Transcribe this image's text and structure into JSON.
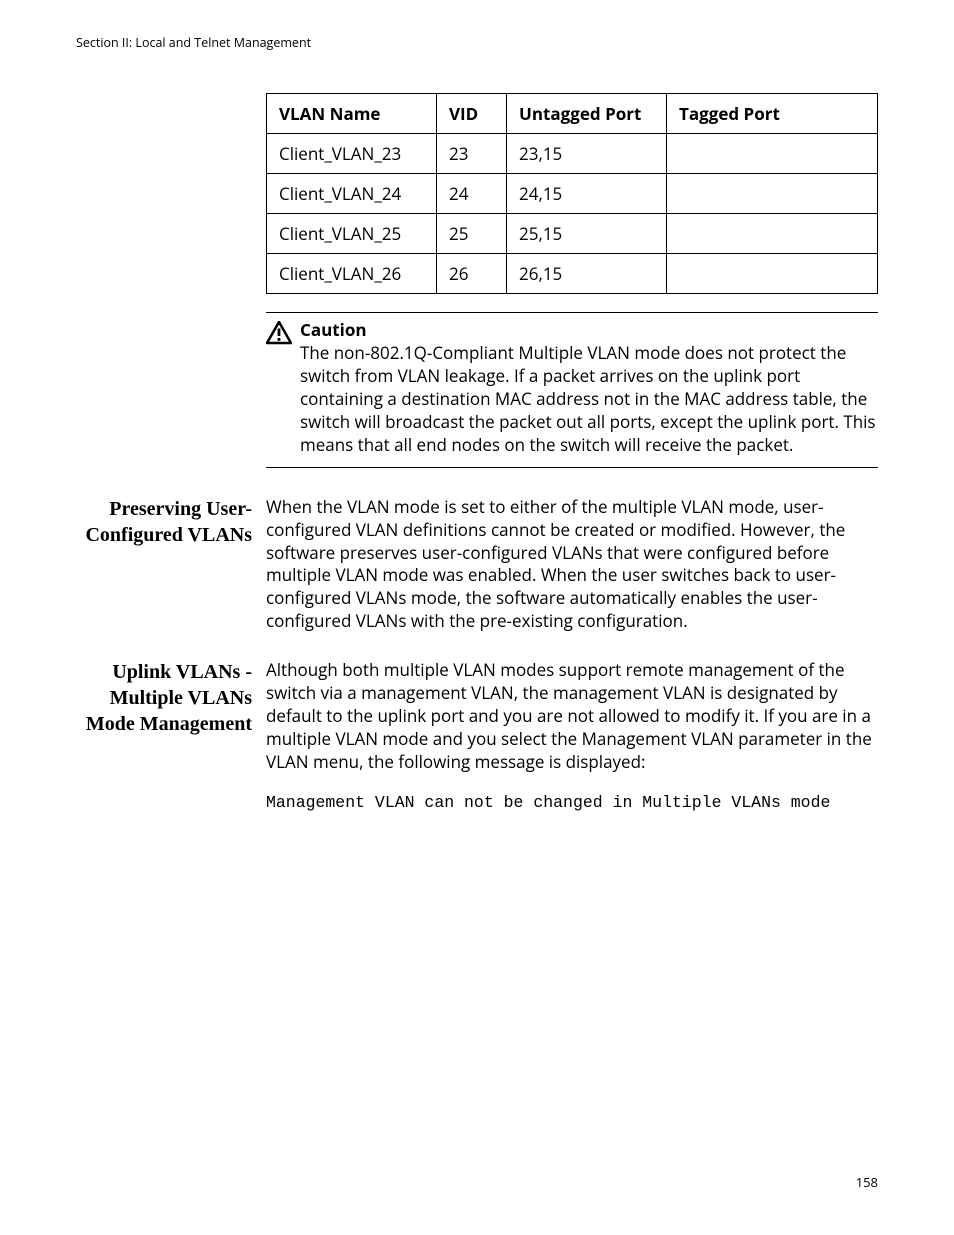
{
  "running_head": "Section II: Local and Telnet Management",
  "page_number": "158",
  "table": {
    "headers": [
      "VLAN Name",
      "VID",
      "Untagged Port",
      "Tagged Port"
    ],
    "rows": [
      {
        "name": "Client_VLAN_23",
        "vid": "23",
        "untagged": "23,15",
        "tagged": ""
      },
      {
        "name": "Client_VLAN_24",
        "vid": "24",
        "untagged": "24,15",
        "tagged": ""
      },
      {
        "name": "Client_VLAN_25",
        "vid": "25",
        "untagged": "25,15",
        "tagged": ""
      },
      {
        "name": "Client_VLAN_26",
        "vid": "26",
        "untagged": "26,15",
        "tagged": ""
      }
    ]
  },
  "caution": {
    "label": "Caution",
    "text": "The non-802.1Q-Compliant Multiple VLAN mode does not protect the switch from VLAN leakage. If a packet arrives on the uplink port containing a destination MAC address not in the MAC address table, the switch will broadcast the packet out all ports, except the uplink port. This means that all end nodes on the switch will receive the packet."
  },
  "sections": {
    "preserving": {
      "heading": "Preserving User-Configured VLANs",
      "body": "When the VLAN mode is set to either of the multiple VLAN mode, user-configured VLAN definitions cannot be created or modified. However, the software preserves user-configured VLANs that were configured before multiple VLAN mode was enabled. When the user switches back to user-configured VLANs mode, the software automatically enables the user-configured VLANs with the pre-existing configuration."
    },
    "uplink": {
      "heading": "Uplink VLANs - Multiple VLANs Mode Management",
      "body": "Although both multiple VLAN modes support remote management of the switch via a management VLAN, the management VLAN is designated by default to the uplink port and you are not allowed to modify it. If you are in a multiple VLAN mode and you select the Management VLAN parameter in the VLAN menu, the following message is displayed:",
      "code": "Management VLAN can not be changed in Multiple VLANs mode"
    }
  }
}
